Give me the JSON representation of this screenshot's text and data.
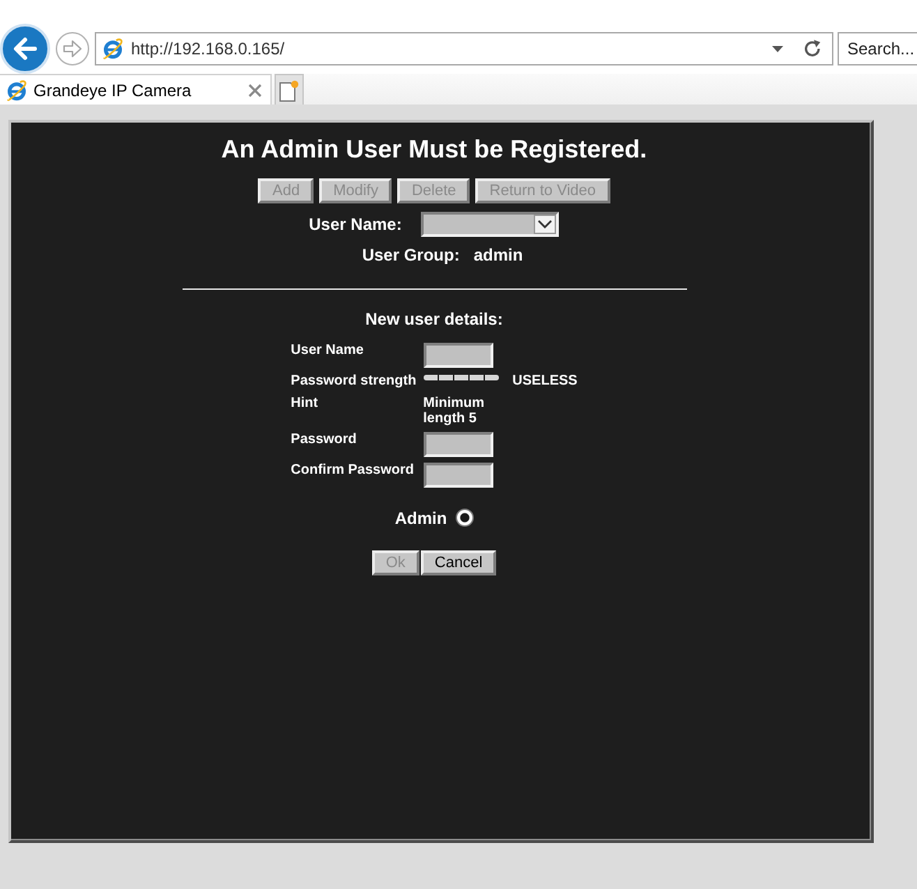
{
  "browser": {
    "nav_buttons": [
      {
        "kind": "back",
        "disabled": false
      },
      {
        "kind": "forward",
        "disabled": true
      }
    ],
    "address_bar": {
      "url": "http://192.168.0.165/"
    },
    "search_field": {
      "placeholder": "Search..."
    },
    "tabs": [
      {
        "title": "Grandeye IP Camera",
        "selected": true
      }
    ]
  },
  "page": {
    "title": "An Admin User Must be Registered.",
    "toolbar_buttons": [
      {
        "label": "Add",
        "disabled": true
      },
      {
        "label": "Modify",
        "disabled": true
      },
      {
        "label": "Delete",
        "disabled": true
      },
      {
        "label": "Return to Video",
        "disabled": true
      }
    ],
    "user_name_select": {
      "label": "User Name:"
    },
    "user_group": {
      "label": "User Group:",
      "value": "admin"
    },
    "new_user": {
      "heading": "New user details:",
      "fields": [
        {
          "kind": "input",
          "label": "User Name"
        },
        {
          "kind": "meter",
          "label": "Password strength",
          "level": 0,
          "reading": "USELESS"
        },
        {
          "kind": "text",
          "label": "Hint",
          "value": "Minimum length 5"
        },
        {
          "kind": "input",
          "label": "Password"
        },
        {
          "kind": "input",
          "label": "Confirm Password"
        }
      ]
    },
    "role_options": [
      {
        "label": "Admin",
        "selected": true
      }
    ],
    "form_buttons": [
      {
        "label": "Ok",
        "disabled": true
      },
      {
        "label": "Cancel",
        "disabled": false
      }
    ]
  }
}
